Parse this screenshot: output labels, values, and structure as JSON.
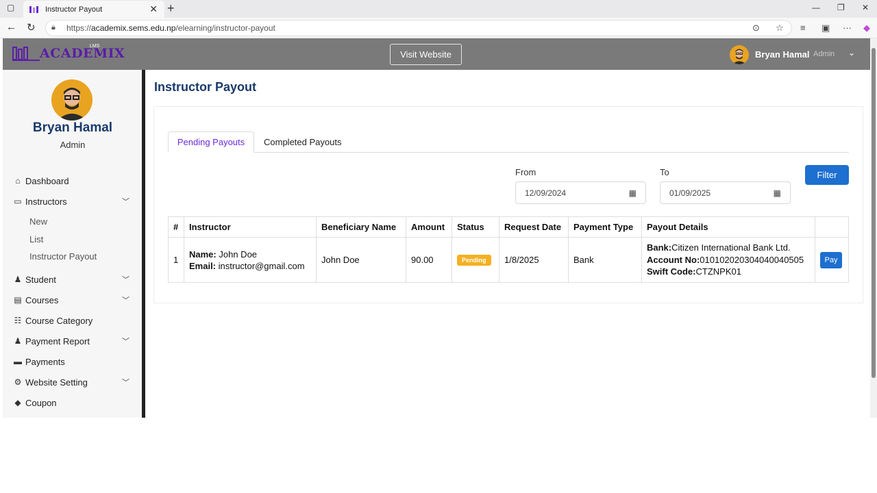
{
  "browser": {
    "tab_title": "Instructor Payout",
    "url_scheme": "https://",
    "url_host": "academix.sems.edu.np",
    "url_path": "/elearning/instructor-payout"
  },
  "header": {
    "logo_text": "ACADEMIX",
    "logo_sub": "LMS",
    "visit_website": "Visit Website",
    "user_name": "Bryan Hamal",
    "user_role": "Admin"
  },
  "sidebar": {
    "profile_name": "Bryan Hamal",
    "profile_role": "Admin",
    "items": [
      {
        "label": "Dashboard",
        "icon": "home-icon"
      },
      {
        "label": "Instructors",
        "icon": "instructor-icon"
      },
      {
        "label": "Student",
        "icon": "student-icon"
      },
      {
        "label": "Courses",
        "icon": "book-icon"
      },
      {
        "label": "Course Category",
        "icon": "list-icon"
      },
      {
        "label": "Payment Report",
        "icon": "report-icon"
      },
      {
        "label": "Payments",
        "icon": "card-icon"
      },
      {
        "label": "Website Setting",
        "icon": "gears-icon"
      },
      {
        "label": "Coupon",
        "icon": "tag-icon"
      }
    ],
    "instructor_sub": [
      "New",
      "List",
      "Instructor Payout"
    ]
  },
  "main": {
    "title": "Instructor Payout",
    "tabs": [
      {
        "label": "Pending Payouts",
        "active": true
      },
      {
        "label": "Completed Payouts",
        "active": false
      }
    ],
    "filter": {
      "from_label": "From",
      "from_value": "12/09/2024",
      "to_label": "To",
      "to_value": "01/09/2025",
      "button": "Filter"
    },
    "table": {
      "headers": [
        "#",
        "Instructor",
        "Beneficiary Name",
        "Amount",
        "Status",
        "Request Date",
        "Payment Type",
        "Payout Details",
        ""
      ],
      "rows": [
        {
          "num": "1",
          "name_label": "Name:",
          "name": "John Doe",
          "email_label": "Email:",
          "email": "instructor@gmail.com",
          "beneficiary": "John Doe",
          "amount": "90.00",
          "status": "Pending",
          "request_date": "1/8/2025",
          "payment_type": "Bank",
          "bank_label": "Bank:",
          "bank": "Citizen International Bank Ltd.",
          "account_label": "Account No:",
          "account": "010102020304040040505",
          "swift_label": "Swift Code:",
          "swift": "CTZNPK01",
          "action": "Pay"
        }
      ]
    }
  },
  "colors": {
    "header_bg": "#7a7a7a",
    "primary": "#1d6fd0",
    "title": "#1a3a6b",
    "active_tab": "#6b2bd6",
    "badge": "#f5b021"
  }
}
